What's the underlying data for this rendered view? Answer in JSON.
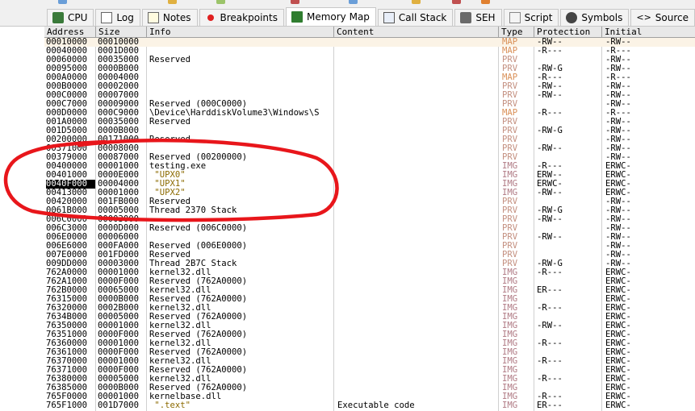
{
  "tabs": [
    {
      "id": "cpu",
      "label": "CPU",
      "icon": "cpu-icon",
      "active": false
    },
    {
      "id": "log",
      "label": "Log",
      "icon": "log-icon",
      "active": false
    },
    {
      "id": "notes",
      "label": "Notes",
      "icon": "notes-icon",
      "active": false
    },
    {
      "id": "breakpoints",
      "label": "Breakpoints",
      "icon": "breakpoint-dot-icon",
      "active": false
    },
    {
      "id": "memory-map",
      "label": "Memory Map",
      "icon": "memory-map-icon",
      "active": true
    },
    {
      "id": "call-stack",
      "label": "Call Stack",
      "icon": "call-stack-icon",
      "active": false
    },
    {
      "id": "seh",
      "label": "SEH",
      "icon": "seh-icon",
      "active": false
    },
    {
      "id": "script",
      "label": "Script",
      "icon": "script-icon",
      "active": false
    },
    {
      "id": "symbols",
      "label": "Symbols",
      "icon": "symbols-icon",
      "active": false
    },
    {
      "id": "source",
      "label": "Source",
      "icon": "source-icon",
      "active": false
    },
    {
      "id": "references",
      "label": "",
      "icon": "references-icon",
      "active": false
    }
  ],
  "columns": {
    "address": "Address",
    "size": "Size",
    "info": "Info",
    "content": "Content",
    "type": "Type",
    "protection": "Protection",
    "initial": "Initial"
  },
  "colors": {
    "map": "#d98f56",
    "prv": "#c49080",
    "img": "#b07a84",
    "highlight_row": "#fbf3e6",
    "annotation": "#e8161b"
  },
  "rows": [
    {
      "address": "00010000",
      "size": "00010000",
      "info": "",
      "content": "",
      "type": "MAP",
      "protection": "-RW--",
      "initial": "-RW--",
      "highlight": true
    },
    {
      "address": "00040000",
      "size": "0001D000",
      "info": "",
      "content": "",
      "type": "MAP",
      "protection": "-R---",
      "initial": "-R---"
    },
    {
      "address": "00060000",
      "size": "00035000",
      "info": "Reserved",
      "content": "",
      "type": "PRV",
      "protection": "",
      "initial": "-RW--"
    },
    {
      "address": "00095000",
      "size": "0000B000",
      "info": "",
      "content": "",
      "type": "PRV",
      "protection": "-RW-G",
      "initial": "-RW--"
    },
    {
      "address": "000A0000",
      "size": "00004000",
      "info": "",
      "content": "",
      "type": "MAP",
      "protection": "-R---",
      "initial": "-R---"
    },
    {
      "address": "000B0000",
      "size": "00002000",
      "info": "",
      "content": "",
      "type": "PRV",
      "protection": "-RW--",
      "initial": "-RW--"
    },
    {
      "address": "000C0000",
      "size": "00007000",
      "info": "",
      "content": "",
      "type": "PRV",
      "protection": "-RW--",
      "initial": "-RW--"
    },
    {
      "address": "000C7000",
      "size": "00009000",
      "info": "Reserved (000C0000)",
      "content": "",
      "type": "PRV",
      "protection": "",
      "initial": "-RW--"
    },
    {
      "address": "000D0000",
      "size": "000C9000",
      "info": "\\Device\\HarddiskVolume3\\Windows\\S",
      "content": "",
      "type": "MAP",
      "protection": "-R---",
      "initial": "-R---"
    },
    {
      "address": "001A0000",
      "size": "00035000",
      "info": "Reserved",
      "content": "",
      "type": "PRV",
      "protection": "",
      "initial": "-RW--"
    },
    {
      "address": "001D5000",
      "size": "0000B000",
      "info": "",
      "content": "",
      "type": "PRV",
      "protection": "-RW-G",
      "initial": "-RW--"
    },
    {
      "address": "00200000",
      "size": "00171000",
      "info": "Reserved",
      "content": "",
      "type": "PRV",
      "protection": "",
      "initial": "-RW--"
    },
    {
      "address": "00371000",
      "size": "00008000",
      "info": "",
      "content": "",
      "type": "PRV",
      "protection": "-RW--",
      "initial": "-RW--"
    },
    {
      "address": "00379000",
      "size": "00087000",
      "info": "Reserved (00200000)",
      "content": "",
      "type": "PRV",
      "protection": "",
      "initial": "-RW--"
    },
    {
      "address": "00400000",
      "size": "00001000",
      "info": "testing.exe",
      "content": "",
      "type": "IMG",
      "protection": "-R---",
      "initial": "ERWC-"
    },
    {
      "address": "00401000",
      "size": "0000E000",
      "info": " \"UPX0\"",
      "content": "",
      "type": "IMG",
      "protection": "ERW--",
      "initial": "ERWC-"
    },
    {
      "address": "0040F000",
      "size": "00004000",
      "info": " \"UPX1\"",
      "content": "",
      "type": "IMG",
      "protection": "ERWC-",
      "initial": "ERWC-",
      "selected": true
    },
    {
      "address": "00413000",
      "size": "00001000",
      "info": " \"UPX2\"",
      "content": "",
      "type": "IMG",
      "protection": "-RW--",
      "initial": "ERWC-"
    },
    {
      "address": "00420000",
      "size": "001FB000",
      "info": "Reserved",
      "content": "",
      "type": "PRV",
      "protection": "",
      "initial": "-RW--"
    },
    {
      "address": "0061B000",
      "size": "00005000",
      "info": "Thread 2370 Stack",
      "content": "",
      "type": "PRV",
      "protection": "-RW-G",
      "initial": "-RW--"
    },
    {
      "address": "006C0000",
      "size": "00003000",
      "info": "",
      "content": "",
      "type": "PRV",
      "protection": "-RW--",
      "initial": "-RW--"
    },
    {
      "address": "006C3000",
      "size": "0000D000",
      "info": "Reserved (006C0000)",
      "content": "",
      "type": "PRV",
      "protection": "",
      "initial": "-RW--"
    },
    {
      "address": "006E0000",
      "size": "00006000",
      "info": "",
      "content": "",
      "type": "PRV",
      "protection": "-RW--",
      "initial": "-RW--"
    },
    {
      "address": "006E6000",
      "size": "000FA000",
      "info": "Reserved (006E0000)",
      "content": "",
      "type": "PRV",
      "protection": "",
      "initial": "-RW--"
    },
    {
      "address": "007E0000",
      "size": "001FD000",
      "info": "Reserved",
      "content": "",
      "type": "PRV",
      "protection": "",
      "initial": "-RW--"
    },
    {
      "address": "009DD000",
      "size": "00003000",
      "info": "Thread 2B7C Stack",
      "content": "",
      "type": "PRV",
      "protection": "-RW-G",
      "initial": "-RW--"
    },
    {
      "address": "762A0000",
      "size": "00001000",
      "info": "kernel32.dll",
      "content": "",
      "type": "IMG",
      "protection": "-R---",
      "initial": "ERWC-"
    },
    {
      "address": "762A1000",
      "size": "0000F000",
      "info": "Reserved (762A0000)",
      "content": "",
      "type": "IMG",
      "protection": "",
      "initial": "ERWC-"
    },
    {
      "address": "762B0000",
      "size": "00065000",
      "info": "kernel32.dll",
      "content": "",
      "type": "IMG",
      "protection": "ER---",
      "initial": "ERWC-"
    },
    {
      "address": "76315000",
      "size": "0000B000",
      "info": "Reserved (762A0000)",
      "content": "",
      "type": "IMG",
      "protection": "",
      "initial": "ERWC-"
    },
    {
      "address": "76320000",
      "size": "0002B000",
      "info": "kernel32.dll",
      "content": "",
      "type": "IMG",
      "protection": "-R---",
      "initial": "ERWC-"
    },
    {
      "address": "7634B000",
      "size": "00005000",
      "info": "Reserved (762A0000)",
      "content": "",
      "type": "IMG",
      "protection": "",
      "initial": "ERWC-"
    },
    {
      "address": "76350000",
      "size": "00001000",
      "info": "kernel32.dll",
      "content": "",
      "type": "IMG",
      "protection": "-RW--",
      "initial": "ERWC-"
    },
    {
      "address": "76351000",
      "size": "0000F000",
      "info": "Reserved (762A0000)",
      "content": "",
      "type": "IMG",
      "protection": "",
      "initial": "ERWC-"
    },
    {
      "address": "76360000",
      "size": "00001000",
      "info": "kernel32.dll",
      "content": "",
      "type": "IMG",
      "protection": "-R---",
      "initial": "ERWC-"
    },
    {
      "address": "76361000",
      "size": "0000F000",
      "info": "Reserved (762A0000)",
      "content": "",
      "type": "IMG",
      "protection": "",
      "initial": "ERWC-"
    },
    {
      "address": "76370000",
      "size": "00001000",
      "info": "kernel32.dll",
      "content": "",
      "type": "IMG",
      "protection": "-R---",
      "initial": "ERWC-"
    },
    {
      "address": "76371000",
      "size": "0000F000",
      "info": "Reserved (762A0000)",
      "content": "",
      "type": "IMG",
      "protection": "",
      "initial": "ERWC-"
    },
    {
      "address": "76380000",
      "size": "00005000",
      "info": "kernel32.dll",
      "content": "",
      "type": "IMG",
      "protection": "-R---",
      "initial": "ERWC-"
    },
    {
      "address": "76385000",
      "size": "0000B000",
      "info": "Reserved (762A0000)",
      "content": "",
      "type": "IMG",
      "protection": "",
      "initial": "ERWC-"
    },
    {
      "address": "765F0000",
      "size": "00001000",
      "info": "kernelbase.dll",
      "content": "",
      "type": "IMG",
      "protection": "-R---",
      "initial": "ERWC-"
    },
    {
      "address": "765F1000",
      "size": "001D7000",
      "info": " \".text\"",
      "content": "Executable code",
      "type": "IMG",
      "protection": "ER---",
      "initial": "ERWC-"
    }
  ]
}
